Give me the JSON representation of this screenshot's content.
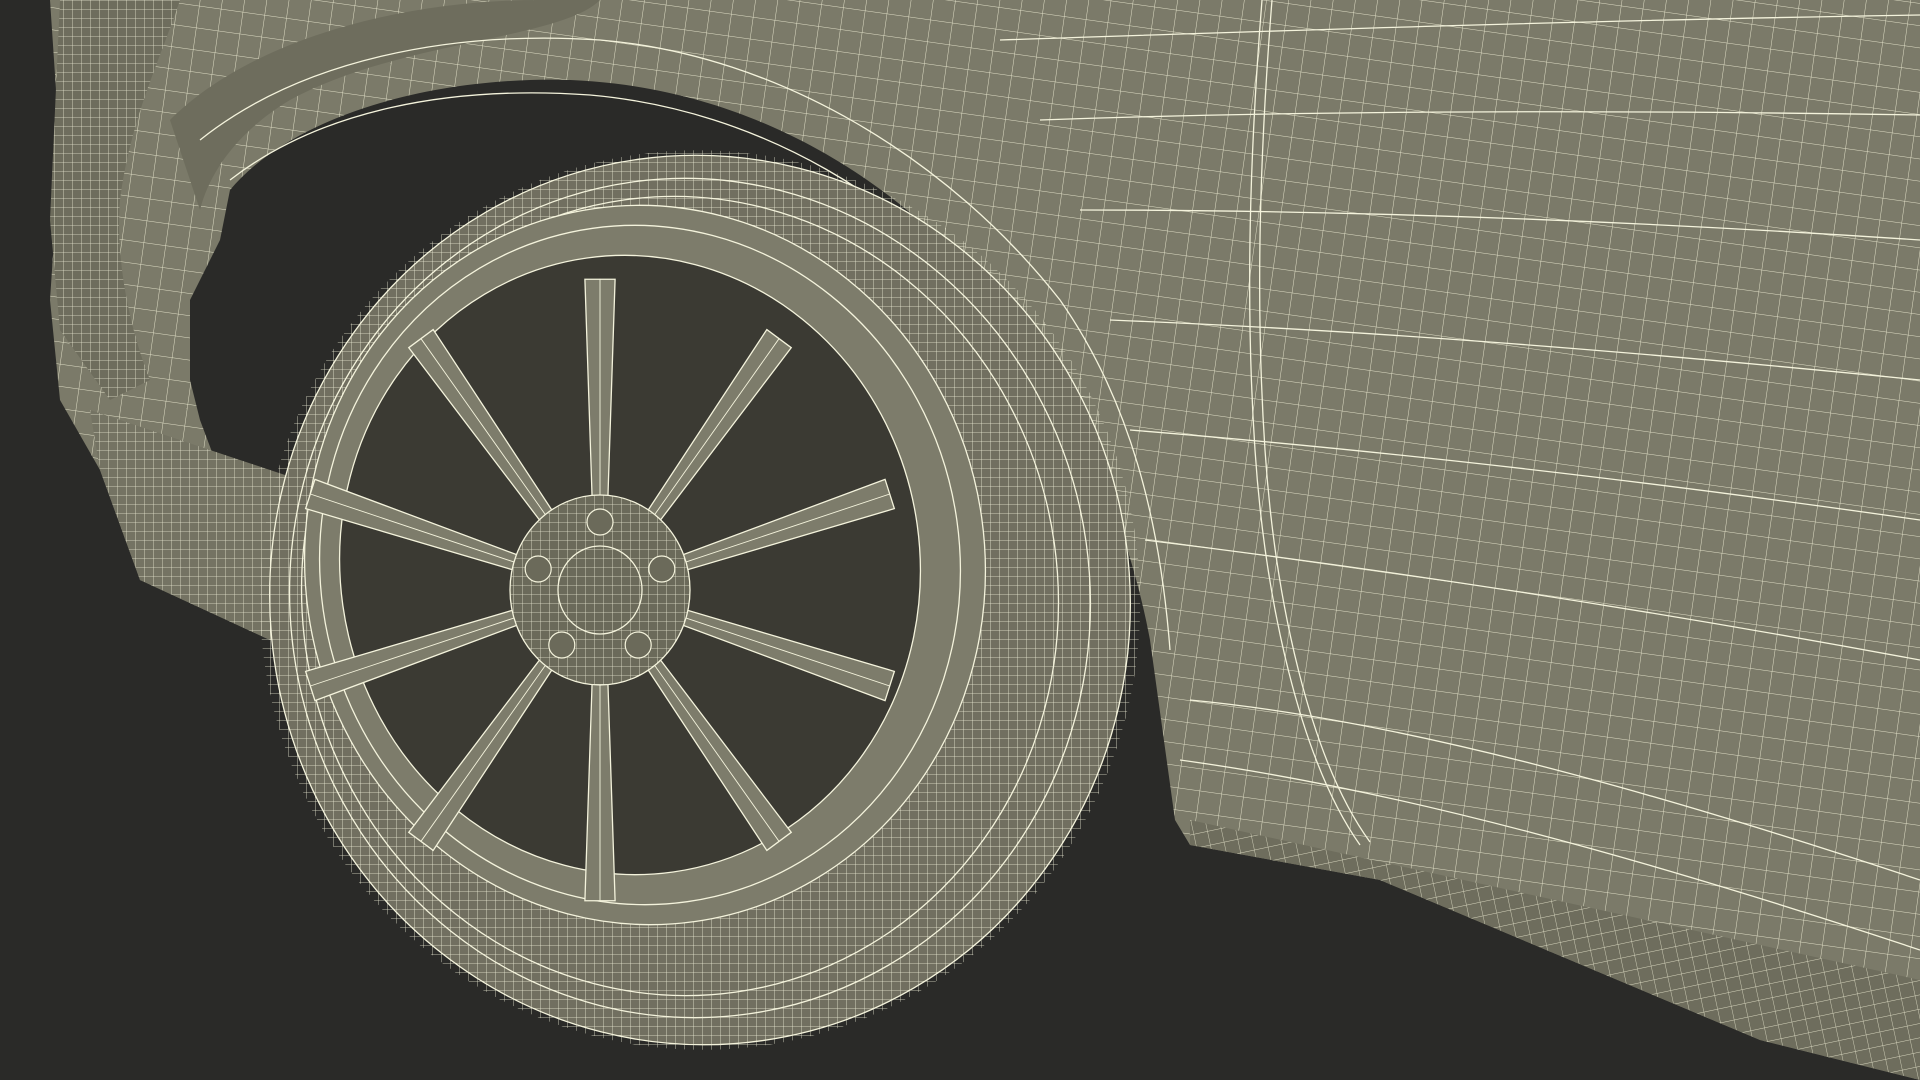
{
  "scene": {
    "kind": "3d-wireframe-render",
    "subject_icon": "car-wheel-wireframe",
    "colors": {
      "background": "#2a2a28",
      "body_fill": "#7b7a69",
      "body_shade": "#6e6d5d",
      "tire_fill": "#716f60",
      "rim_fill": "#7d7c6b",
      "hub_fill": "#6b6a5a",
      "wire_color": "#f4f3dc"
    },
    "wheel": {
      "spoke_count": 10,
      "lug_nut_count": 5
    }
  }
}
